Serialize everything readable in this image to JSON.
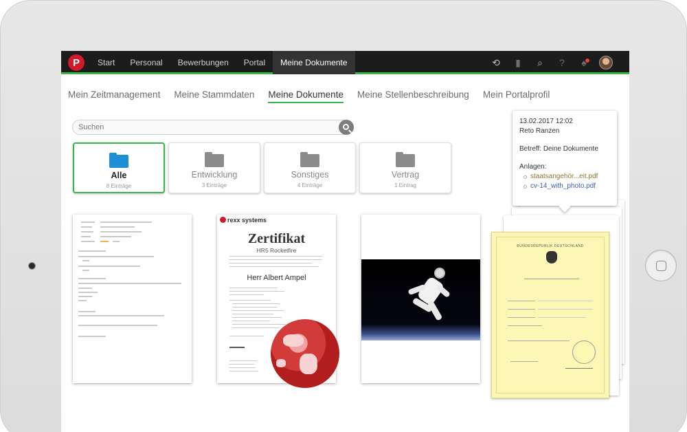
{
  "topbar": {
    "logo_letter": "P",
    "nav": [
      "Start",
      "Personal",
      "Bewerbungen",
      "Portal",
      "Meine Dokumente"
    ],
    "active_nav": "Meine Dokumente",
    "icons": [
      "history-icon",
      "bookmark-icon",
      "search-icon",
      "help-icon",
      "notification-bell-icon",
      "user-avatar"
    ],
    "accent_color": "#39b54a"
  },
  "subtabs": [
    "Mein Zeitmanagement",
    "Meine Stammdaten",
    "Meine Dokumente",
    "Meine Stellenbeschreibung",
    "Mein Portalprofil"
  ],
  "search": {
    "placeholder": "Suchen"
  },
  "folders": [
    {
      "name": "Alle",
      "count": "8 Einträge",
      "active": true
    },
    {
      "name": "Entwicklung",
      "count": "3 Einträge"
    },
    {
      "name": "Sonstiges",
      "count": "4 Einträge"
    },
    {
      "name": "Vertrag",
      "count": "1 Eintrag"
    }
  ],
  "documents": {
    "certificate": {
      "brand": "rexx systems",
      "title": "Zertifikat",
      "subtitle": "HR5 Rocketfire",
      "name": "Herr Albert Ampel"
    },
    "german_certificate": {
      "header": "BUNDESREPUBLIK DEUTSCHLAND"
    }
  },
  "tooltip": {
    "date": "13.02.2017 12:02",
    "author": "Reto Ranzen",
    "subject": "Betreff: Deine Dokumente",
    "attachments_label": "Anlagen:",
    "attachments": [
      "staatsangehör...eit.pdf",
      "cv-14_with_photo.pdf"
    ]
  }
}
